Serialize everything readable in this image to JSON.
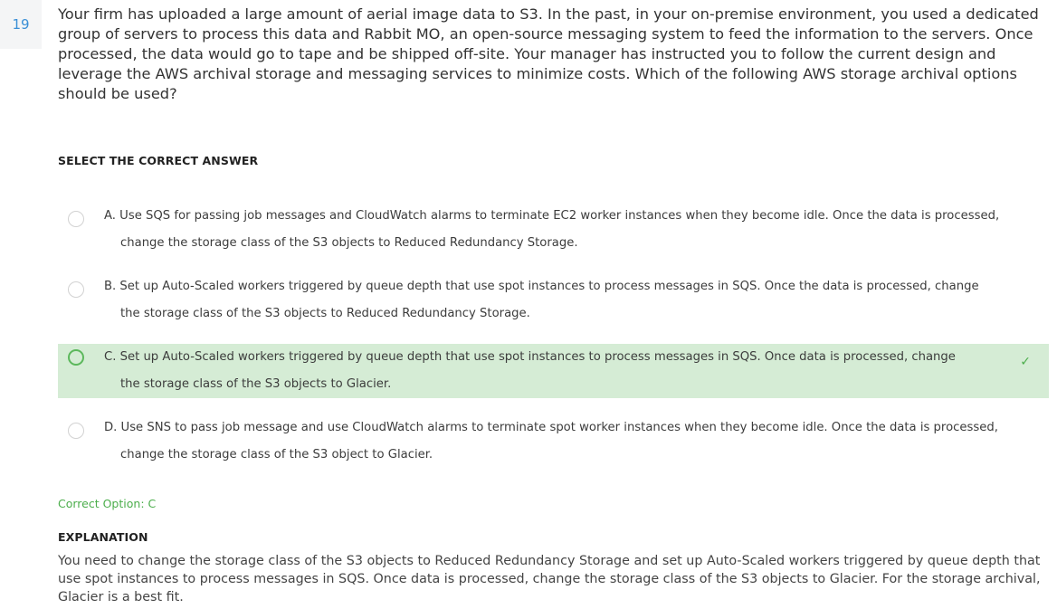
{
  "question": {
    "number": "19",
    "text": "Your firm has uploaded a large amount of aerial image data to S3. In the past, in your on-premise environment, you used a dedicated group of servers to process this data and Rabbit MO, an open-source messaging system to feed the information to the servers. Once processed, the data would go to tape and be shipped off-site. Your manager has instructed you to follow the current design and leverage the AWS archival storage and messaging services to minimize costs. Which of the following AWS storage archival options should be used?"
  },
  "select_heading": "SELECT THE CORRECT ANSWER",
  "options": [
    {
      "line1": "A. Use SQS for passing job messages and CloudWatch alarms to terminate EC2 worker instances when they become idle. Once the data is processed,",
      "line2": "change the storage class of the S3 objects to Reduced Redundancy Storage.",
      "correct": false
    },
    {
      "line1": "B. Set up Auto-Scaled workers triggered by queue depth that use spot instances to process messages in SQS. Once the data is processed, change",
      "line2": "the storage class of the S3 objects to Reduced Redundancy Storage.",
      "correct": false
    },
    {
      "line1": "C. Set up Auto-Scaled workers triggered by queue depth that use spot instances to process messages in SQS. Once data is processed, change",
      "line2": "the storage class of the S3 objects to Glacier.",
      "correct": true
    },
    {
      "line1": "D. Use SNS to pass job message and use CloudWatch alarms to terminate spot worker instances when they become idle. Once the data is processed,",
      "line2": "change the storage class of the S3 object to Glacier.",
      "correct": false
    }
  ],
  "check_icon": "✓",
  "correct_option": "Correct Option: C",
  "explanation_heading": "EXPLANATION",
  "explanation": "You need to change the storage class of the S3 objects to Reduced Redundancy Storage and set up Auto-Scaled workers triggered by queue depth that use spot instances to process messages in SQS. Once data is processed, change the storage class of the S3 objects to Glacier. For the storage archival, Glacier is a best fit.",
  "colors": {
    "accent_blue": "#3a8fd6",
    "correct_green": "#4cae4c",
    "correct_bg": "#d5ecd5"
  }
}
